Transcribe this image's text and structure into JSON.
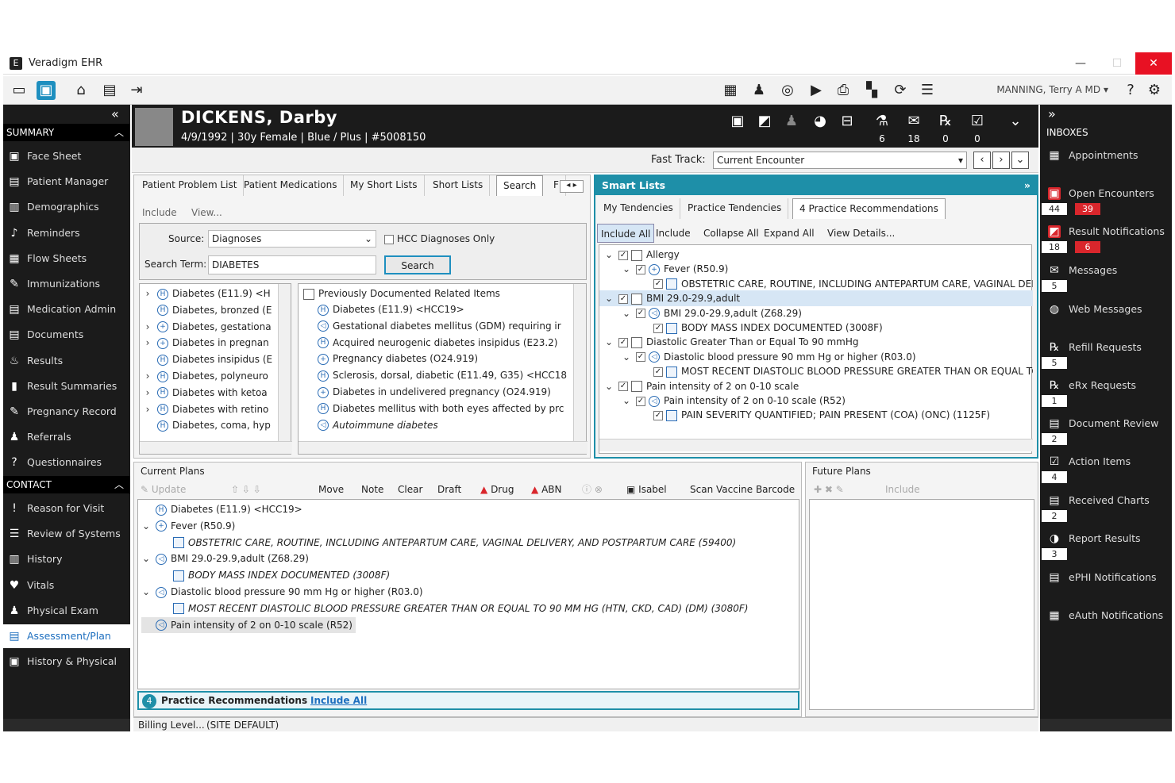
{
  "app": {
    "title": "Veradigm EHR",
    "logo": "E",
    "minimize": "—",
    "maximize": "☐",
    "close": "✕"
  },
  "user": {
    "name": "MANNING, Terry A MD"
  },
  "patient": {
    "name": "DICKENS, Darby",
    "dob": "4/9/1992",
    "age_sex": "30y Female",
    "plan": "Blue / Plus",
    "id": "#5008150"
  },
  "header_counts": {
    "lab": "6",
    "mail": "18",
    "rx": "0",
    "tasks": "0"
  },
  "fasttrack": {
    "label": "Fast Track:",
    "value": "Current Encounter"
  },
  "left_nav": {
    "summary_label": "SUMMARY",
    "contact_label": "CONTACT",
    "summary": [
      "Face Sheet",
      "Patient Manager",
      "Demographics",
      "Reminders",
      "Flow Sheets",
      "Immunizations",
      "Medication Admin",
      "Documents",
      "Results",
      "Result Summaries",
      "Pregnancy Record",
      "Referrals",
      "Questionnaires"
    ],
    "contact": [
      "Reason for Visit",
      "Review of Systems",
      "History",
      "Vitals",
      "Physical Exam",
      "Assessment/Plan",
      "History & Physical"
    ]
  },
  "inboxes": {
    "label": "INBOXES",
    "items": [
      {
        "label": "Appointments"
      },
      {
        "label": "Open Encounters",
        "c1": "44",
        "c2": "39"
      },
      {
        "label": "Result Notifications",
        "c1": "18",
        "c2": "6"
      },
      {
        "label": "Messages",
        "c1": "5"
      },
      {
        "label": "Web Messages"
      },
      {
        "label": "Refill Requests",
        "c1": "5"
      },
      {
        "label": "eRx Requests",
        "c1": "1"
      },
      {
        "label": "Document Review",
        "c1": "2"
      },
      {
        "label": "Action Items",
        "c1": "4"
      },
      {
        "label": "Received Charts",
        "c1": "2"
      },
      {
        "label": "Report Results",
        "c1": "3"
      },
      {
        "label": "ePHI Notifications"
      },
      {
        "label": "eAuth Notifications"
      }
    ]
  },
  "problem_tabs": [
    "Patient Problem List",
    "Patient Medications",
    "My Short Lists",
    "Short Lists",
    "Search",
    "F"
  ],
  "problem_links": {
    "include": "Include",
    "view": "View..."
  },
  "search": {
    "source_label": "Source:",
    "source_value": "Diagnoses",
    "hcc_label": "HCC Diagnoses Only",
    "term_label": "Search Term:",
    "term_value": "DIABETES",
    "button": "Search"
  },
  "search_results": [
    "Diabetes (E11.9) <H",
    "Diabetes, bronzed (E",
    "Diabetes, gestationa",
    "Diabetes in pregnan",
    "Diabetes insipidus (E",
    "Diabetes, polyneuro",
    "Diabetes with ketoa",
    "Diabetes with retino",
    "Diabetes, coma, hyp"
  ],
  "related_items": {
    "header": "Previously Documented Related Items",
    "items": [
      "Diabetes (E11.9) <HCC19>",
      "Gestational diabetes mellitus (GDM) requiring ir",
      "Acquired neurogenic diabetes insipidus (E23.2)",
      "Pregnancy diabetes (O24.919)",
      "Sclerosis, dorsal, diabetic (E11.49, G35) <HCC18",
      "Diabetes in undelivered pregnancy (O24.919)",
      "Diabetes mellitus with both eyes affected by prc",
      "Autoimmune diabetes"
    ]
  },
  "smart_lists": {
    "title": "Smart Lists",
    "tabs": [
      "My Tendencies",
      "Practice Tendencies",
      "4 Practice Recommendations"
    ],
    "toolbar": [
      "Include All",
      "Include",
      "Collapse All",
      "Expand All",
      "View Details..."
    ],
    "tree": [
      "Allergy",
      "Fever (R50.9)",
      "OBSTETRIC CARE, ROUTINE, INCLUDING ANTEPARTUM CARE, VAGINAL DELI",
      "BMI 29.0-29.9,adult",
      "BMI 29.0-29.9,adult (Z68.29)",
      "BODY MASS INDEX DOCUMENTED (3008F)",
      "Diastolic Greater Than or Equal To 90 mmHg",
      "Diastolic blood pressure 90 mm Hg or higher (R03.0)",
      "MOST RECENT DIASTOLIC BLOOD PRESSURE GREATER THAN OR EQUAL TC",
      "Pain intensity of 2 on 0-10 scale",
      "Pain intensity of 2 on 0-10 scale (R52)",
      "PAIN SEVERITY QUANTIFIED; PAIN PRESENT (COA) (ONC) (1125F)"
    ]
  },
  "current_plans": {
    "title": "Current Plans",
    "toolbar": [
      "Update",
      "Move",
      "Note",
      "Clear",
      "Draft",
      "Drug",
      "ABN",
      "Isabel",
      "Scan Vaccine Barcode"
    ],
    "items": [
      "Diabetes (E11.9) <HCC19>",
      "Fever (R50.9)",
      "OBSTETRIC CARE, ROUTINE, INCLUDING ANTEPARTUM CARE, VAGINAL DELIVERY, AND POSTPARTUM CARE (59400)",
      "BMI 29.0-29.9,adult (Z68.29)",
      "BODY MASS INDEX DOCUMENTED (3008F)",
      "Diastolic blood pressure 90 mm Hg or higher (R03.0)",
      "MOST RECENT DIASTOLIC BLOOD PRESSURE GREATER THAN OR EQUAL TO 90 MM HG (HTN, CKD, CAD) (DM) (3080F)",
      "Pain intensity of 2 on 0-10 scale (R52)"
    ],
    "rec_count": "4",
    "rec_label": "Practice Recommendations",
    "rec_link": "Include All"
  },
  "future_plans": {
    "title": "Future Plans",
    "include": "Include"
  },
  "billing": {
    "label": "Billing Level...",
    "value": "(SITE DEFAULT)"
  },
  "colors": {
    "accent": "#1e8fa8",
    "nav_bg": "#1b1b1b",
    "alert": "#d9262c"
  }
}
